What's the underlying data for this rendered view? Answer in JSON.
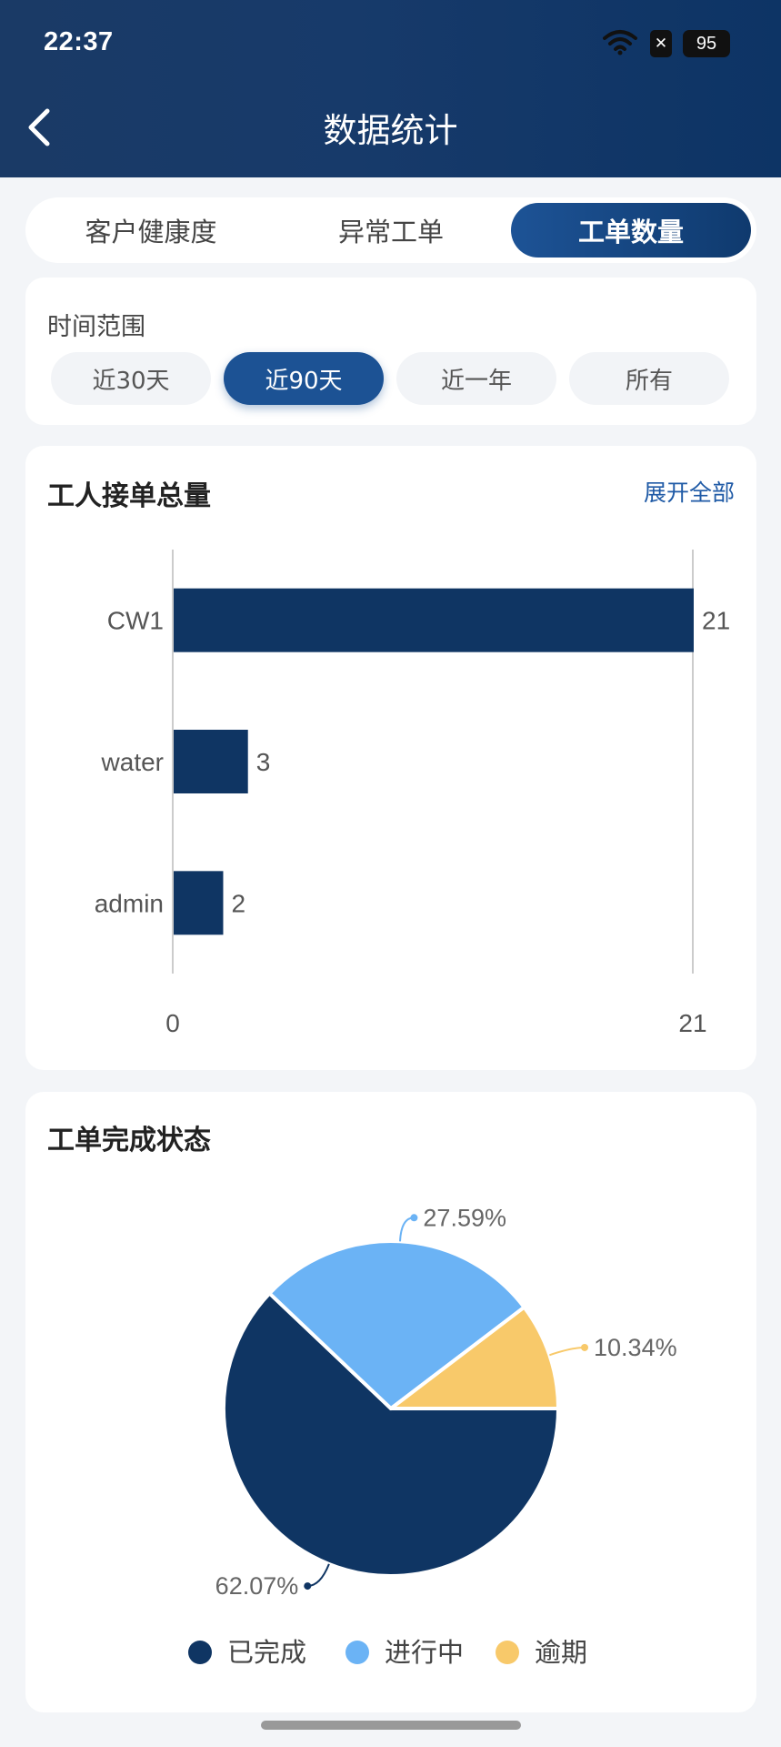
{
  "status_bar": {
    "time": "22:37",
    "battery": "95",
    "x_badge": "✕",
    "wifi_icon": "wifi-icon"
  },
  "nav": {
    "title": "数据统计",
    "back_icon": "chevron-left-icon"
  },
  "tabs": [
    {
      "label": "客户健康度",
      "active": false
    },
    {
      "label": "异常工单",
      "active": false
    },
    {
      "label": "工单数量",
      "active": true
    }
  ],
  "time_range": {
    "label": "时间范围",
    "options": [
      {
        "label": "近30天",
        "active": false
      },
      {
        "label": "近90天",
        "active": true
      },
      {
        "label": "近一年",
        "active": false
      },
      {
        "label": "所有",
        "active": false
      }
    ]
  },
  "workers_card": {
    "title": "工人接单总量",
    "expand_label": "展开全部",
    "chart_data": {
      "type": "bar",
      "orientation": "horizontal",
      "categories": [
        "CW1",
        "water",
        "admin"
      ],
      "values": [
        21,
        3,
        2
      ],
      "data_labels": [
        "21",
        "3",
        "2"
      ],
      "xlim": [
        0,
        21
      ],
      "x_ticks": [
        "0",
        "21"
      ],
      "color": "#0f3563"
    }
  },
  "status_card": {
    "title": "工单完成状态",
    "chart_data": {
      "type": "pie",
      "slices": [
        {
          "name": "已完成",
          "value": 62.07,
          "label": "62.07%",
          "color": "#0f3563"
        },
        {
          "name": "进行中",
          "value": 27.59,
          "label": "27.59%",
          "color": "#6bb3f5"
        },
        {
          "name": "逾期",
          "value": 10.34,
          "label": "10.34%",
          "color": "#f8c96a"
        }
      ],
      "legend": "bottom"
    }
  }
}
